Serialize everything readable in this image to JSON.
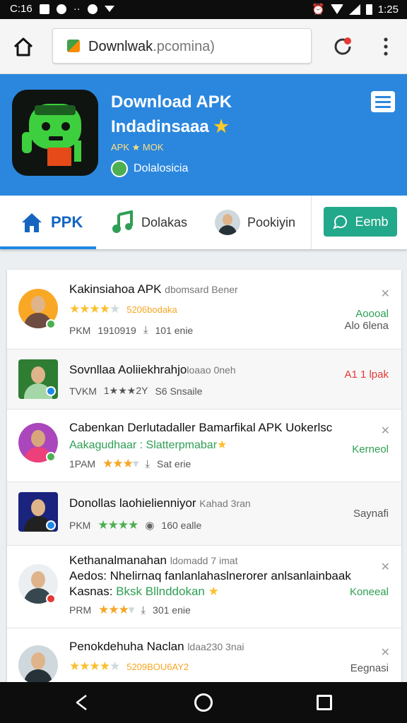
{
  "status_bar": {
    "time": "C:16",
    "clock": "1:25",
    "icons": [
      "photo-icon",
      "pinwheel-icon",
      "dots-icon",
      "record-icon",
      "triangle-icon",
      "alarm-icon",
      "wifi-icon",
      "signal-icon",
      "battery-icon"
    ]
  },
  "browser": {
    "url_main": "Downlwak",
    "url_rest": ".pcomina)",
    "icons": [
      "home-icon",
      "lock-icon",
      "reload-icon",
      "overflow-menu-icon"
    ]
  },
  "hero": {
    "title": "Download APK",
    "subtitle": "Indadinsaaa",
    "subtitle_star": "★",
    "tag": "APK ★ MOK",
    "developer": "Dolalosicia",
    "colors": {
      "background": "#2b87de",
      "icon_green": "#3ecf3e"
    }
  },
  "tabs": [
    {
      "label": "PPK",
      "icon": "home-icon"
    },
    {
      "label": "Dolakas",
      "icon": "music-note-icon"
    },
    {
      "label": "Pookiyin",
      "icon": "person-avatar"
    }
  ],
  "share_button": {
    "label": "Eemb",
    "icon": "chat-bubble-icon",
    "color": "#22a88a"
  },
  "list": [
    {
      "title": "Kakinsiahoa APK",
      "title_sub": "dbomsard Bener",
      "rating": 4,
      "rating_text": "5206bodaka",
      "meta_left": "PKM",
      "meta_num": "1910919",
      "downloads": "101 enie",
      "status": "Aoooal",
      "status_sub": "Alo 6lena",
      "close": "✕"
    },
    {
      "title": "Sovnllaa Aoliiekhrahjo",
      "title_sub": "loaao 0neh",
      "meta_left": "TVKM",
      "meta_num": "1★★★2Y",
      "downloads": "S6 Snsaile",
      "status": "A1 1 lpak"
    },
    {
      "title": "Cabenkan Derlutadaller Bamarfikal APK Uokerlsc",
      "subtitle": "Aakagudhaar : Slatterpmabar",
      "subtitle_star": "★",
      "rating": 3,
      "meta_left": "1PAM",
      "downloads": "Sat erie",
      "status": "Kerneol",
      "close": "✕"
    },
    {
      "title": "Donollas laohielienniyor",
      "title_sub": "Kahad 3ran",
      "rating": 4,
      "meta_left": "PKM",
      "downloads": "160 ealle",
      "status": "Saynafi"
    },
    {
      "title": "Kethanalmanahan",
      "title_sub": "ldomadd 7 imat",
      "line2": "Aedos: Nhelirnaq fanlanlahaslnerorer anlsanlainbaak",
      "line3_label": "Kasnas:",
      "line3_value": "Bksk Bllnddokan",
      "line3_star": "★",
      "rating": 3,
      "meta_left": "PRM",
      "downloads": "301 enie",
      "status": "Koneeal",
      "close": "✕"
    },
    {
      "title": "Penokdehuha Naclan",
      "title_sub": "ldaa230 3nai",
      "rating": 4,
      "rating_text": "5209BOU6AY2",
      "status": "Eegnasi",
      "close": "✕"
    }
  ],
  "nav_bar": {
    "icons": [
      "back-icon",
      "home-circle-icon",
      "recents-icon"
    ]
  }
}
